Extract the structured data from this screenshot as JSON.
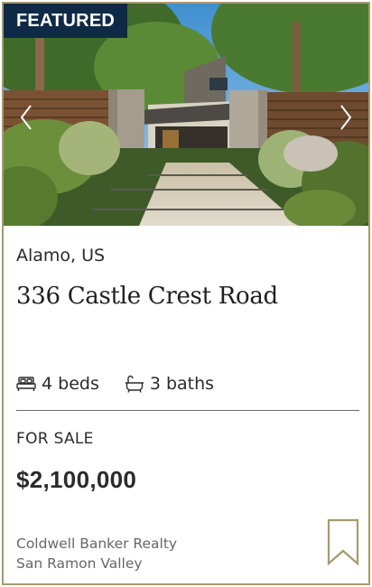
{
  "listing": {
    "badge": "FEATURED",
    "location": "Alamo, US",
    "address": "336 Castle Crest Road",
    "beds": "4 beds",
    "baths": "3 baths",
    "status": "FOR SALE",
    "price": "$2,100,000",
    "brokerage_line1": "Coldwell Banker Realty",
    "brokerage_line2": "San Ramon Valley"
  },
  "icons": {
    "prev": "chevron-left-icon",
    "next": "chevron-right-icon",
    "beds": "bed-icon",
    "baths": "bathtub-icon",
    "save": "bookmark-icon"
  },
  "colors": {
    "badge_bg": "#0e2a47",
    "accent_gold": "#a89a6e",
    "text": "#2b2b2b",
    "muted": "#666666"
  }
}
